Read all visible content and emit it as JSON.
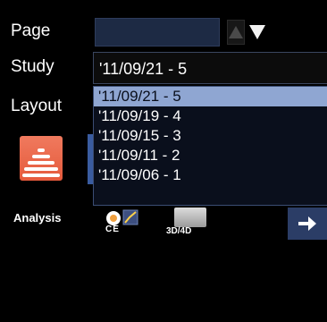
{
  "labels": {
    "page": "Page",
    "study": "Study",
    "layout": "Layout",
    "analysis": "Analysis"
  },
  "page_field": {
    "value": ""
  },
  "study_field": {
    "value": "'11/09/21 - 5"
  },
  "study_options": [
    "'11/09/21 - 5",
    "'11/09/19 - 4",
    "'11/09/15 - 3",
    "'11/09/11 - 2",
    "'11/09/06 - 1"
  ],
  "selected_option_index": 0,
  "analysis_buttons": {
    "ce": "CE",
    "three_d_four_d": "3D/4D"
  },
  "icons": {
    "spin_up": "triangle-up-icon",
    "spin_down": "triangle-down-icon",
    "logo": "ultrasound-waves-icon",
    "next": "arrow-right-icon"
  },
  "colors": {
    "background": "#000000",
    "field_bg": "#1d2a44",
    "selection": "#8fa6d2",
    "logo": "#e96a4b",
    "button": "#2b3d66"
  }
}
